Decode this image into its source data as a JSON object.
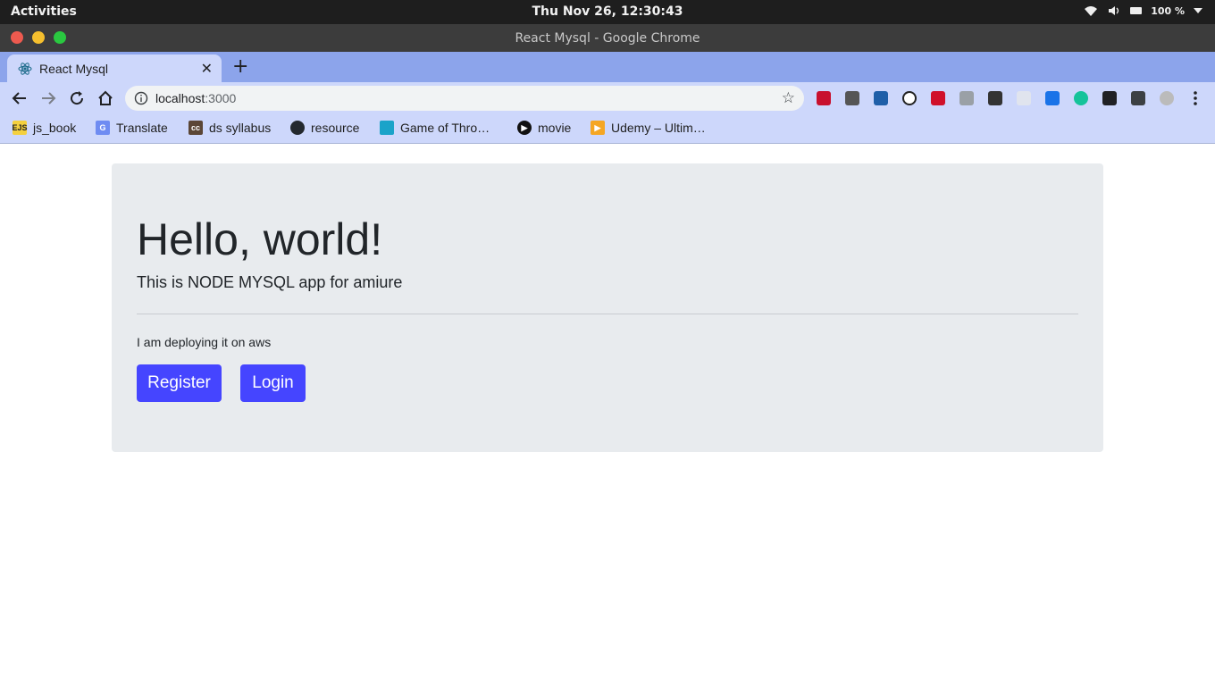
{
  "os_topbar": {
    "activities": "Activities",
    "clock": "Thu Nov 26, 12:30:43",
    "battery": "100 %"
  },
  "window": {
    "title": "React Mysql - Google Chrome"
  },
  "tabs": [
    {
      "label": "React Mysql",
      "active": true
    }
  ],
  "omnibox": {
    "host": "localhost",
    "port": ":3000"
  },
  "bookmarks": [
    {
      "label": "js_book",
      "icon": "ejs-icon"
    },
    {
      "label": "Translate",
      "icon": "translate-icon"
    },
    {
      "label": "ds syllabus",
      "icon": "cc-icon"
    },
    {
      "label": "resource",
      "icon": "github-icon"
    },
    {
      "label": "Game of Thro…",
      "icon": "game-icon"
    },
    {
      "label": "movie",
      "icon": "play-icon"
    },
    {
      "label": "Udemy – Ultim…",
      "icon": "udemy-icon"
    }
  ],
  "page": {
    "heading": "Hello, world!",
    "lead": "This is NODE MYSQL app for amiure",
    "note": "I am deploying it on aws",
    "register_label": "Register",
    "login_label": "Login"
  },
  "colors": {
    "button": "#4545ff",
    "jumbotron": "#e8ebee",
    "tabstrip": "#8ca4eb",
    "toolbar": "#cdd7fb"
  }
}
